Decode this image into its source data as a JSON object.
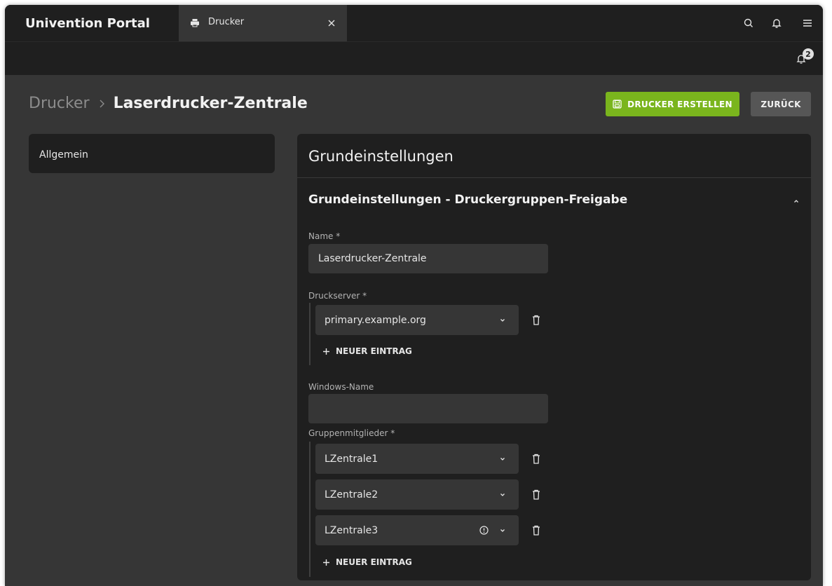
{
  "app": {
    "title": "Univention Portal",
    "tab_label": "Drucker"
  },
  "notifications": {
    "count": "2"
  },
  "breadcrumb": {
    "parent": "Drucker",
    "current": "Laserdrucker-Zentrale"
  },
  "actions": {
    "create_label": "DRUCKER ERSTELLEN",
    "back_label": "ZURÜCK"
  },
  "nav": {
    "items": [
      {
        "label": "Allgemein"
      }
    ]
  },
  "panel": {
    "title": "Grundeinstellungen",
    "section_title": "Grundeinstellungen - Druckergruppen-Freigabe",
    "name": {
      "label": "Name *",
      "value": "Laserdrucker-Zentrale"
    },
    "printserver": {
      "label": "Druckserver *",
      "entries": [
        "primary.example.org"
      ],
      "add_label": "NEUER EINTRAG"
    },
    "windows_name": {
      "label": "Windows-Name",
      "value": ""
    },
    "members": {
      "label": "Gruppenmitglieder *",
      "entries": [
        "LZentrale1",
        "LZentrale2",
        "LZentrale3"
      ],
      "add_label": "NEUER EINTRAG"
    }
  },
  "icons": {
    "tab": "printer-icon",
    "tab_close": "close-icon",
    "search": "search-icon",
    "bell": "bell-icon",
    "menu": "menu-icon",
    "save": "save-icon",
    "collapse": "chevron-up-icon",
    "dropdown": "chevron-down-icon",
    "delete": "trash-icon",
    "warning": "warning-icon",
    "add": "plus-icon"
  },
  "colors": {
    "primary": "#7ab51d",
    "background": "#363636",
    "surface": "#1f1f1f"
  }
}
